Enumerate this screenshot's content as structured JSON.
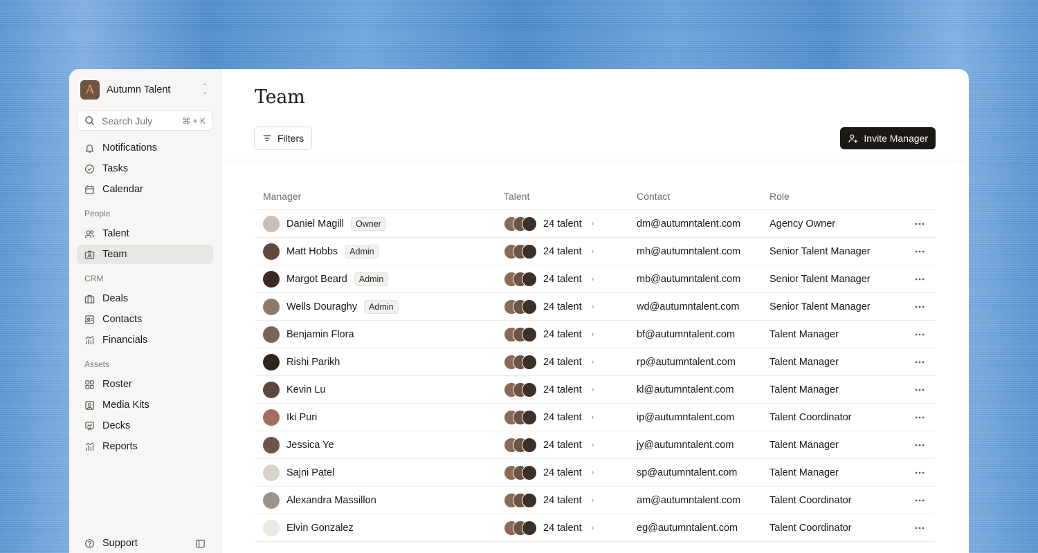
{
  "workspace": {
    "initial": "A",
    "name": "Autumn Talent"
  },
  "search": {
    "placeholder": "Search July",
    "shortcut": "⌘ + K"
  },
  "nav_top": [
    {
      "label": "Notifications",
      "icon": "bell-icon"
    },
    {
      "label": "Tasks",
      "icon": "check-circle-icon"
    },
    {
      "label": "Calendar",
      "icon": "calendar-icon"
    }
  ],
  "sections": [
    {
      "title": "People",
      "items": [
        {
          "label": "Talent",
          "icon": "users-icon",
          "active": false
        },
        {
          "label": "Team",
          "icon": "id-badge-icon",
          "active": true
        }
      ]
    },
    {
      "title": "CRM",
      "items": [
        {
          "label": "Deals",
          "icon": "briefcase-icon",
          "active": false
        },
        {
          "label": "Contacts",
          "icon": "contact-card-icon",
          "active": false
        },
        {
          "label": "Financials",
          "icon": "bar-chart-icon",
          "active": false
        }
      ]
    },
    {
      "title": "Assets",
      "items": [
        {
          "label": "Roster",
          "icon": "grid-icon",
          "active": false
        },
        {
          "label": "Media Kits",
          "icon": "portrait-icon",
          "active": false
        },
        {
          "label": "Decks",
          "icon": "presentation-icon",
          "active": false
        },
        {
          "label": "Reports",
          "icon": "bar-chart-icon",
          "active": false
        }
      ]
    }
  ],
  "support": {
    "label": "Support"
  },
  "page": {
    "title": "Team"
  },
  "toolbar": {
    "filters_label": "Filters",
    "invite_label": "Invite Manager"
  },
  "table": {
    "headers": {
      "manager": "Manager",
      "talent": "Talent",
      "contact": "Contact",
      "role": "Role"
    },
    "rows": [
      {
        "name": "Daniel Magill",
        "badge": "Owner",
        "talent": "24 talent",
        "email": "dm@autumntalent.com",
        "role": "Agency Owner",
        "avatar": "#c9bfb6"
      },
      {
        "name": "Matt Hobbs",
        "badge": "Admin",
        "talent": "24 talent",
        "email": "mh@autumntalent.com",
        "role": "Senior Talent Manager",
        "avatar": "#5e4a3f"
      },
      {
        "name": "Margot Beard",
        "badge": "Admin",
        "talent": "24 talent",
        "email": "mb@autumntalent.com",
        "role": "Senior Talent Manager",
        "avatar": "#3a2a22"
      },
      {
        "name": "Wells Douraghy",
        "badge": "Admin",
        "talent": "24 talent",
        "email": "wd@autumntalent.com",
        "role": "Senior Talent Manager",
        "avatar": "#8c7a6c"
      },
      {
        "name": "Benjamin Flora",
        "badge": "",
        "talent": "24 talent",
        "email": "bf@autumntalent.com",
        "role": "Talent Manager",
        "avatar": "#7a6456"
      },
      {
        "name": "Rishi Parikh",
        "badge": "",
        "talent": "24 talent",
        "email": "rp@autumntalent.com",
        "role": "Talent Manager",
        "avatar": "#2e2520"
      },
      {
        "name": "Kevin Lu",
        "badge": "",
        "talent": "24 talent",
        "email": "kl@autumntalent.com",
        "role": "Talent Manager",
        "avatar": "#5a4a40"
      },
      {
        "name": "Iki Puri",
        "badge": "",
        "talent": "24 talent",
        "email": "ip@autumntalent.com",
        "role": "Talent Coordinator",
        "avatar": "#a0705a"
      },
      {
        "name": "Jessica Ye",
        "badge": "",
        "talent": "24 talent",
        "email": "jy@autumntalent.com",
        "role": "Talent Manager",
        "avatar": "#6b5548"
      },
      {
        "name": "Sajni Patel",
        "badge": "",
        "talent": "24 talent",
        "email": "sp@autumntalent.com",
        "role": "Talent Manager",
        "avatar": "#d8d2cc"
      },
      {
        "name": "Alexandra Massillon",
        "badge": "",
        "talent": "24 talent",
        "email": "am@autumntalent.com",
        "role": "Talent Coordinator",
        "avatar": "#9c948c"
      },
      {
        "name": "Elvin Gonzalez",
        "badge": "",
        "talent": "24 talent",
        "email": "eg@autumntalent.com",
        "role": "Talent Coordinator",
        "avatar": "#ece8e4"
      }
    ]
  },
  "colors": {
    "accent": "#1c1813",
    "sidebar_bg": "#f7f6f4",
    "active_bg": "#e9e7e3"
  }
}
